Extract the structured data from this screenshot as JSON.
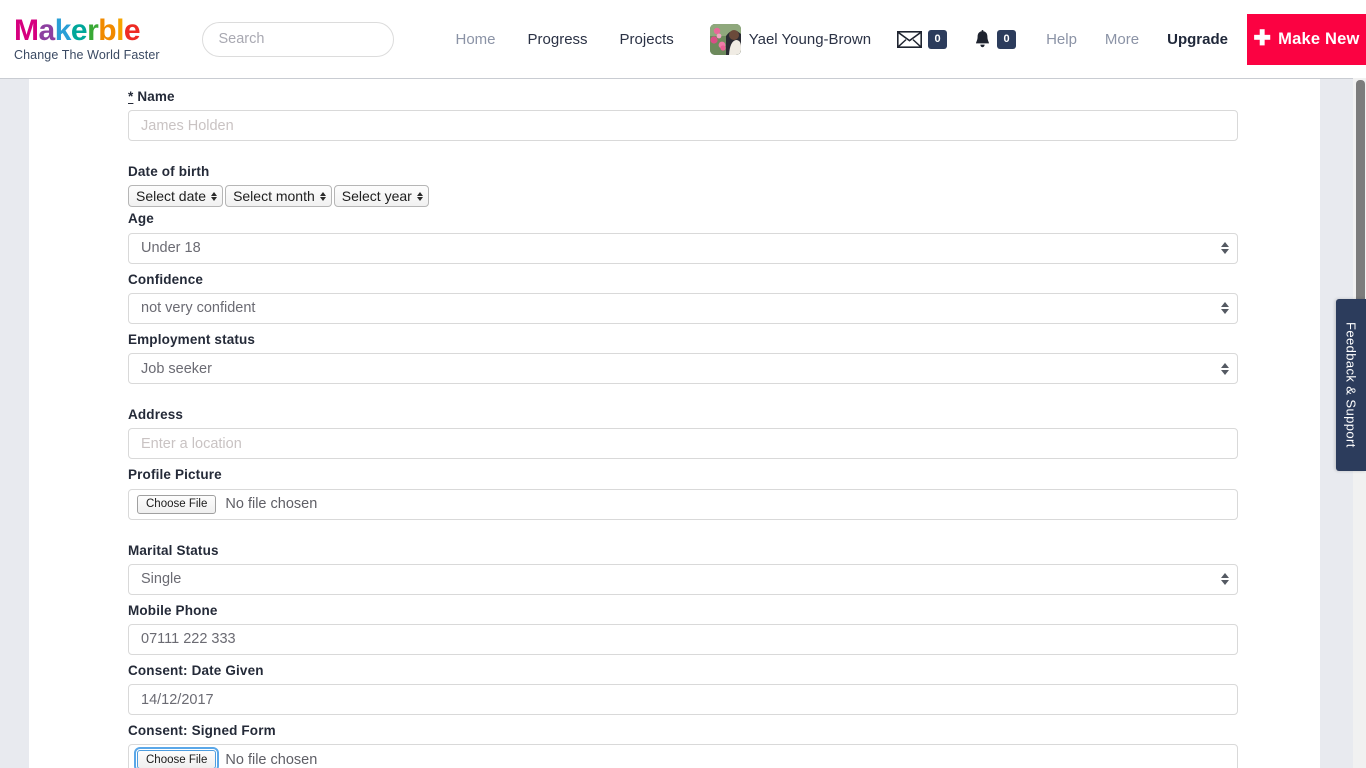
{
  "brand": {
    "name_letters": [
      {
        "ch": "M",
        "color": "#d6007f"
      },
      {
        "ch": "a",
        "color": "#8d3fa0"
      },
      {
        "ch": "k",
        "color": "#2a9fd6"
      },
      {
        "ch": "e",
        "color": "#00a79a"
      },
      {
        "ch": "r",
        "color": "#39a935"
      },
      {
        "ch": "b",
        "color": "#f08a00"
      },
      {
        "ch": "l",
        "color": "#f5a300"
      },
      {
        "ch": "e",
        "color": "#ee2b24"
      }
    ],
    "name": "Makerble",
    "tagline": "Change The World Faster",
    "accent_red": "#fb0242",
    "badge_navy": "#2c3c5c"
  },
  "search": {
    "placeholder": "Search",
    "value": "",
    "icon": "search-icon"
  },
  "nav": {
    "home": "Home",
    "progress": "Progress",
    "projects": "Projects",
    "help": "Help",
    "more": "More",
    "upgrade": "Upgrade",
    "make_new": "Make New",
    "make_new_icon": "plus-icon"
  },
  "account": {
    "user_name": "Yael Young-Brown",
    "avatar_alt": "avatar"
  },
  "notifications": {
    "mail_icon": "envelope-icon",
    "mail_count": "0",
    "bell_icon": "bell-icon",
    "bell_count": "0"
  },
  "feedback": {
    "label": "Feedback & Support"
  },
  "form": {
    "name": {
      "required_mark": "*",
      "label": "Name",
      "placeholder": "James Holden",
      "value": ""
    },
    "dob": {
      "label": "Date of birth",
      "date": "Select date",
      "month": "Select month",
      "year": "Select year"
    },
    "age": {
      "label": "Age",
      "value": "Under 18"
    },
    "confidence": {
      "label": "Confidence",
      "value": "not very confident"
    },
    "employment": {
      "label": "Employment status",
      "value": "Job seeker"
    },
    "address": {
      "label": "Address",
      "placeholder": "Enter a location",
      "value": ""
    },
    "profile_picture": {
      "label": "Profile Picture",
      "button": "Choose File",
      "status": "No file chosen"
    },
    "marital_status": {
      "label": "Marital Status",
      "value": "Single"
    },
    "mobile_phone": {
      "label": "Mobile Phone",
      "value": "07111 222 333"
    },
    "consent_date": {
      "label": "Consent: Date Given",
      "value": "14/12/2017"
    },
    "consent_form": {
      "label": "Consent: Signed Form",
      "button": "Choose File",
      "status": "No file chosen"
    }
  }
}
